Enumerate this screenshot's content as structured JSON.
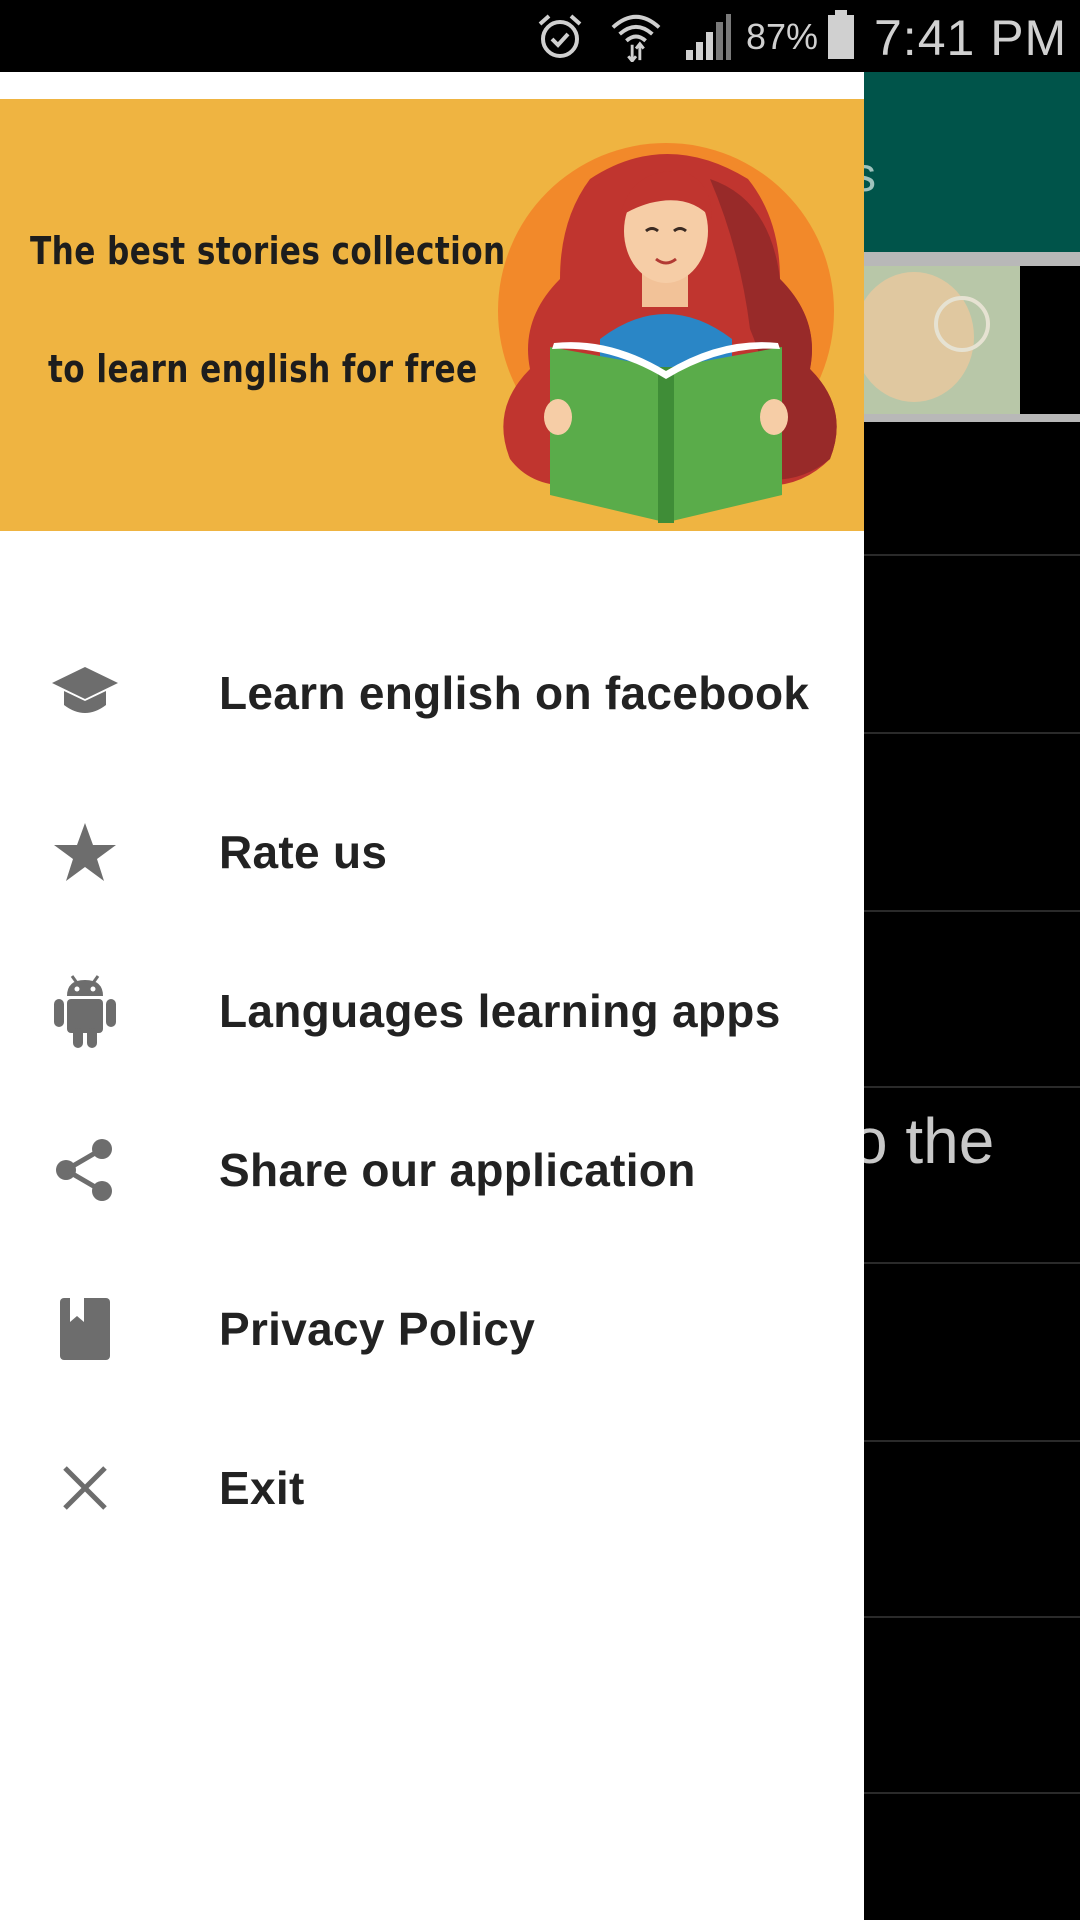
{
  "status_bar": {
    "battery_percent": "87%",
    "time": "7:41 PM",
    "icons": [
      "alarm-icon",
      "wifi-icon",
      "signal-icon",
      "battery-icon"
    ]
  },
  "background_app": {
    "toolbar_color": "#00544a",
    "title_fragment": "s",
    "text_fragment": "o the"
  },
  "drawer": {
    "header": {
      "line1": "The best stories collection",
      "line2": "to learn english for free",
      "background": "#efb441"
    },
    "items": [
      {
        "label": "Learn english on facebook",
        "icon": "graduation-cap-icon"
      },
      {
        "label": "Rate us",
        "icon": "star-icon"
      },
      {
        "label": "Languages learning apps",
        "icon": "android-icon"
      },
      {
        "label": "Share our application",
        "icon": "share-icon"
      },
      {
        "label": "Privacy Policy",
        "icon": "book-icon"
      },
      {
        "label": "Exit",
        "icon": "close-icon"
      }
    ]
  }
}
